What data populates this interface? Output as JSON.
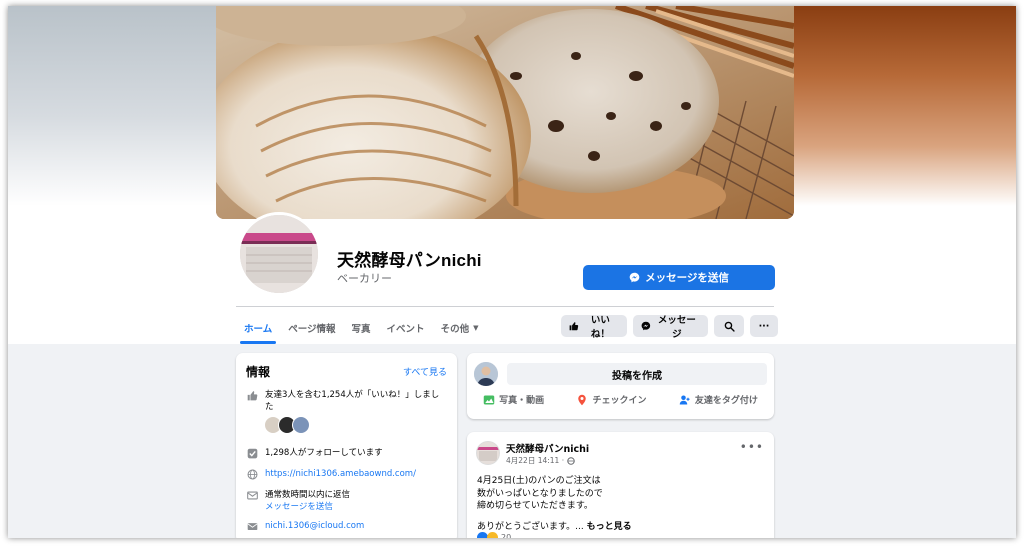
{
  "page": {
    "name": "天然酵母パンnichi",
    "category": "ベーカリー",
    "message_button": "メッセージを送信"
  },
  "tabs": [
    {
      "label": "ホーム"
    },
    {
      "label": "ページ情報"
    },
    {
      "label": "写真"
    },
    {
      "label": "イベント"
    },
    {
      "label": "その他"
    }
  ],
  "actions": {
    "like": "いいね！",
    "message": "メッセージ",
    "more": "···"
  },
  "intro": {
    "title": "情報",
    "see_all": "すべて見る",
    "likes_text": "友達3人を含む1,254人が「いいね！」しました",
    "followers_text": "1,298人がフォローしています",
    "website": "https://nichi1306.amebaownd.com/",
    "response_time": "通常数時間以内に返信",
    "send_message": "メッセージを送信",
    "email": "nichi.1306@icloud.com"
  },
  "composer": {
    "placeholder": "投稿を作成",
    "photo_video": "写真・動画",
    "checkin": "チェックイン",
    "tag_friends": "友達をタグ付け"
  },
  "post": {
    "author": "天然酵母パンnichi",
    "date": "4月22日 14:11 ·",
    "line1": "4月25日(土)のパンのご注文は",
    "line2": "数がいっぱいとなりましたので",
    "line3": "締め切らせていただきます。",
    "line4": "ありがとうございます。...",
    "see_more": "もっと見る",
    "reaction_count": "20"
  },
  "colors": {
    "accent": "#1877f2",
    "primary_button": "#1b74e4",
    "background": "#f0f2f5"
  }
}
